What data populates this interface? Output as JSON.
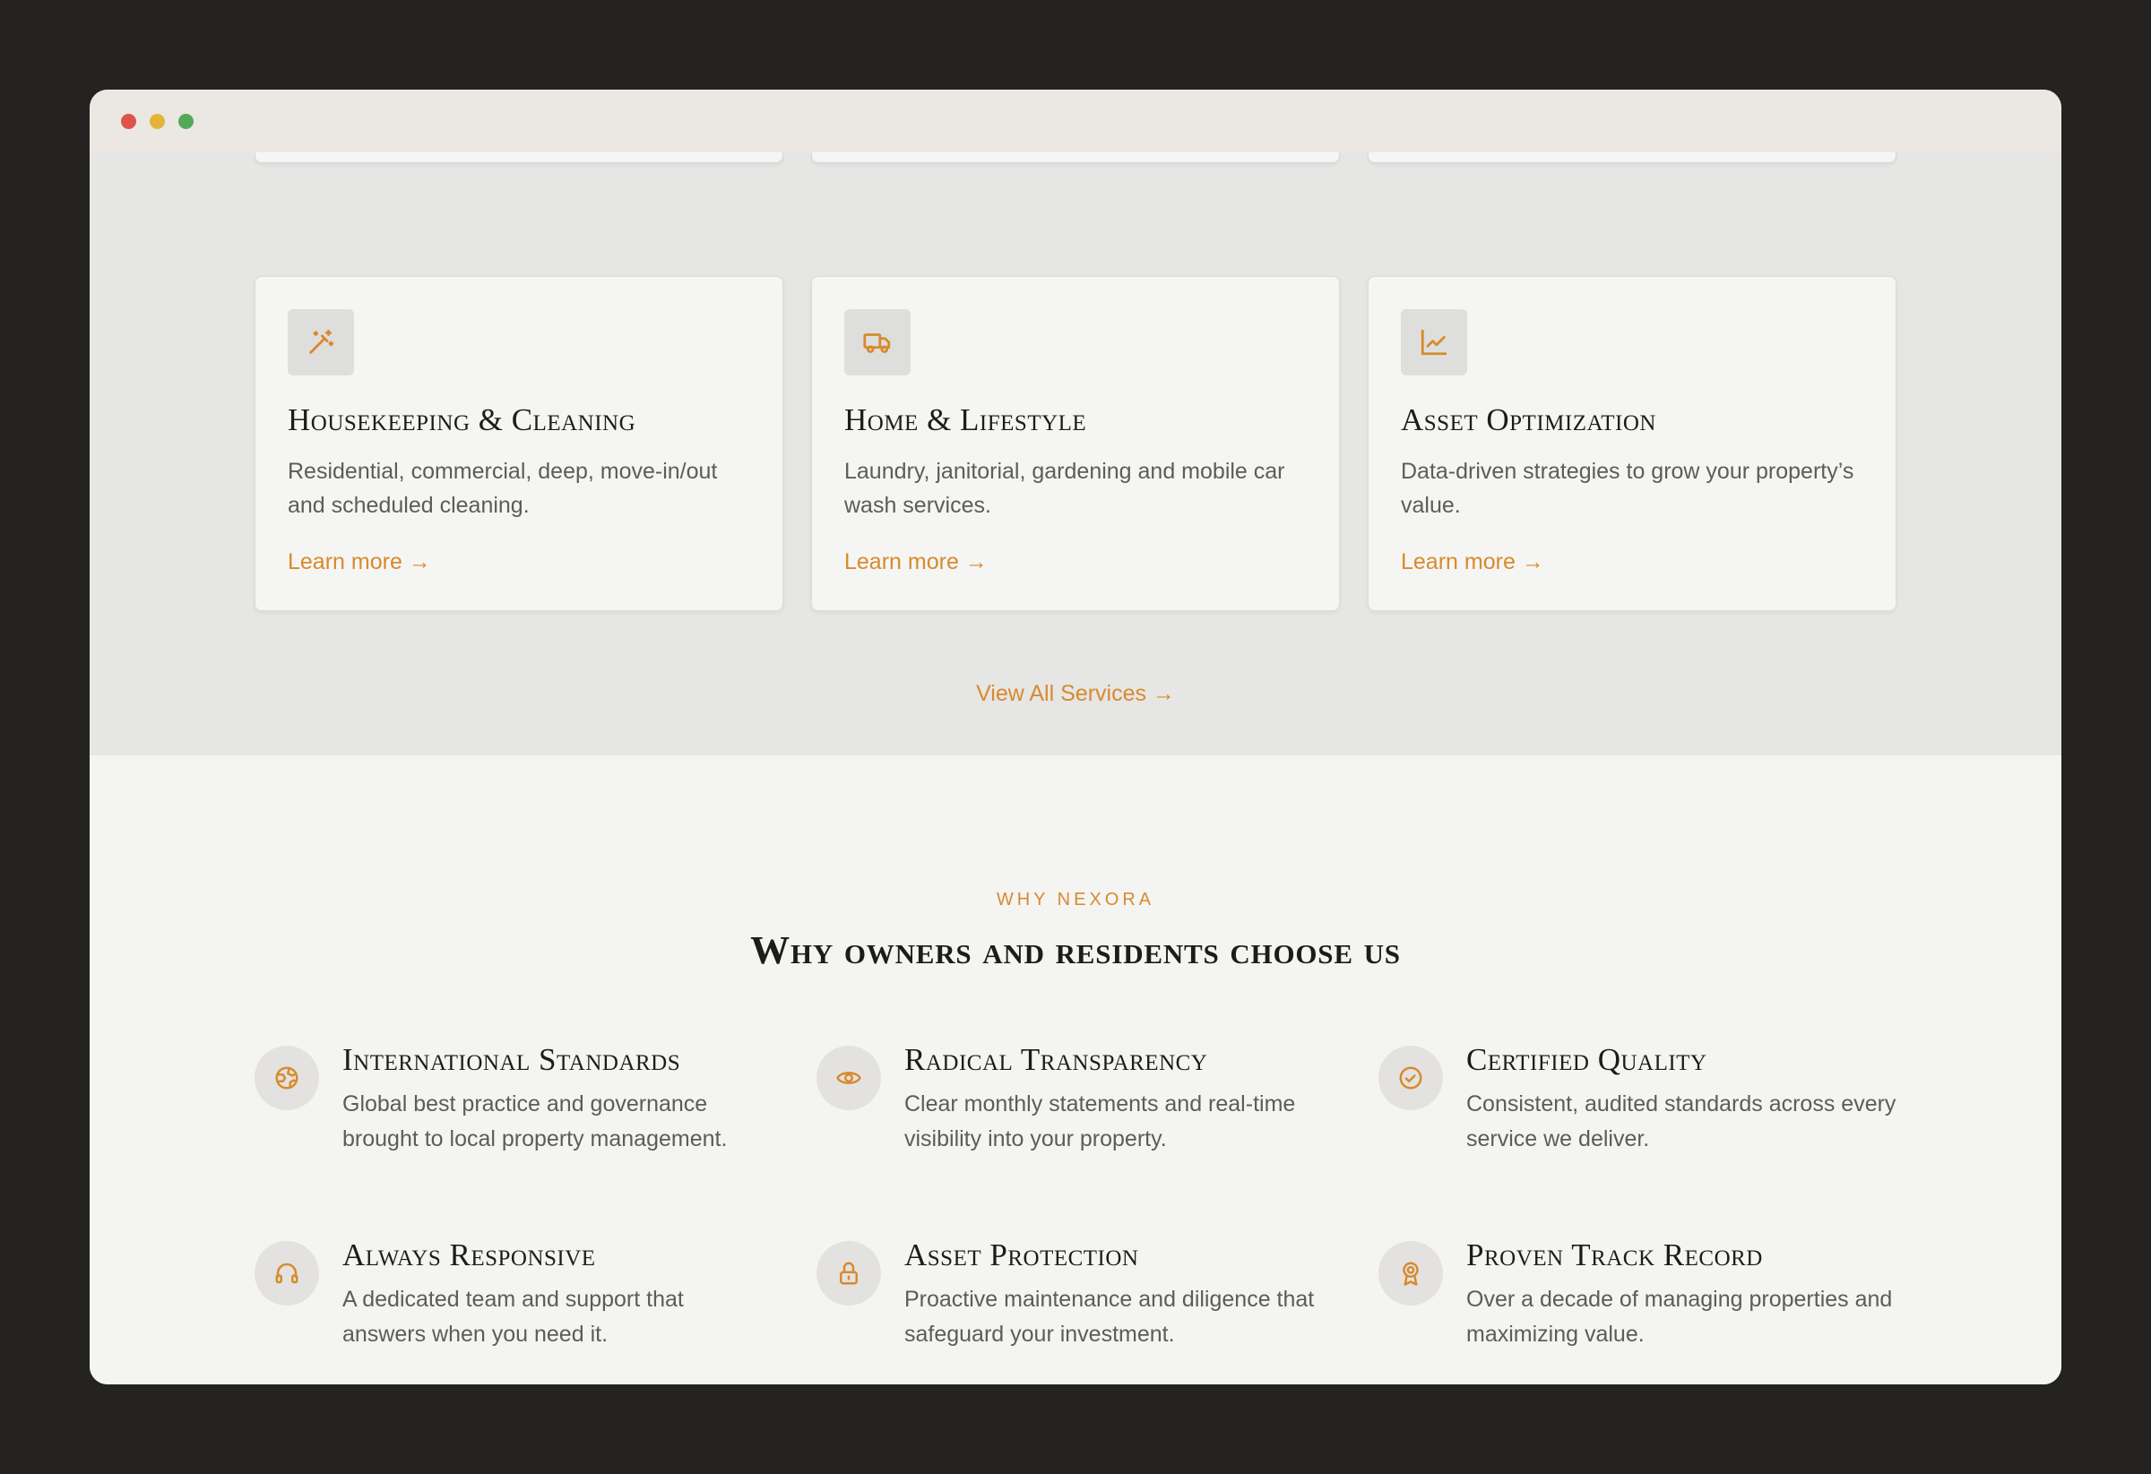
{
  "colors": {
    "accent": "#d88a2d",
    "heading": "#1d1c1b",
    "body_text": "#5d5c5a",
    "services_bg": "#e6e6e5",
    "why_bg": "#f4f4f3"
  },
  "services": {
    "cards": [
      {
        "icon": "magic-wand-icon",
        "title": "Housekeeping & Cleaning",
        "description": "Residential, commercial, deep, move-in/out and scheduled cleaning.",
        "link_label": "Learn more →"
      },
      {
        "icon": "truck-icon",
        "title": "Home & Lifestyle",
        "description": "Laundry, janitorial, gardening and mobile car wash services.",
        "link_label": "Learn more →"
      },
      {
        "icon": "chart-line-icon",
        "title": "Asset Optimization",
        "description": "Data-driven strategies to grow your property’s value.",
        "link_label": "Learn more →"
      }
    ],
    "view_all_label": "View All Services →"
  },
  "why": {
    "eyebrow": "WHY NEXORA",
    "title": "Why owners and residents choose us",
    "features": [
      {
        "icon": "globe-icon",
        "title": "International Standards",
        "description": "Global best practice and governance brought to local property management."
      },
      {
        "icon": "eye-icon",
        "title": "Radical Transparency",
        "description": "Clear monthly statements and real-time visibility into your property."
      },
      {
        "icon": "check-circle-icon",
        "title": "Certified Quality",
        "description": "Consistent, audited standards across every service we deliver."
      },
      {
        "icon": "headphones-icon",
        "title": "Always Responsive",
        "description": "A dedicated team and support that answers when you need it."
      },
      {
        "icon": "lock-icon",
        "title": "Asset Protection",
        "description": "Proactive maintenance and diligence that safeguard your investment."
      },
      {
        "icon": "award-icon",
        "title": "Proven Track Record",
        "description": "Over a decade of managing properties and maximizing value."
      }
    ]
  }
}
